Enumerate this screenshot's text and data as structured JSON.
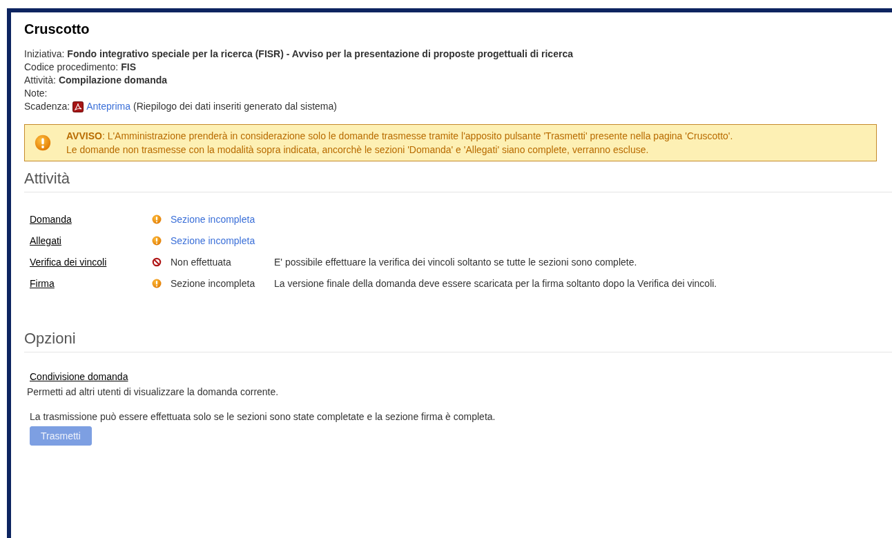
{
  "page": {
    "title": "Cruscotto"
  },
  "info": [
    {
      "label": "Iniziativa:",
      "value": "Fondo integrativo speciale per la ricerca (FISR) - Avviso per la presentazione di proposte progettuali di ricerca"
    },
    {
      "label": "Codice procedimento:",
      "value": "FIS"
    },
    {
      "label": "Attività:",
      "value": "Compilazione domanda"
    },
    {
      "label": "Note:"
    },
    {
      "label": "Scadenza:",
      "link": "Anteprima",
      "note": "(Riepilogo dei dati inseriti generato dal sistema)"
    }
  ],
  "alert": {
    "lines": [
      "**AVVISO**: L'Amministrazione prenderà in considerazione solo le domande trasmesse tramite l'apposito pulsante 'Trasmetti' presente nella pagina 'Cruscotto'.",
      "Le domande non trasmesse con la modalità sopra indicata, ancorchè le sezioni 'Domanda' e 'Allegati' siano complete, verranno escluse."
    ]
  },
  "activities": {
    "heading": "Attività",
    "rows": [
      {
        "name": "Domanda",
        "kind": "warning",
        "status": "Sezione incompleta",
        "status_link": true
      },
      {
        "name": "Allegati",
        "kind": "warning",
        "status": "Sezione incompleta",
        "status_link": true
      },
      {
        "name": "Verifica dei vincoli",
        "kind": "blocked",
        "status": "Non effettuata",
        "status_link": false,
        "note": "E' possibile effettuare la verifica dei vincoli soltanto se tutte le sezioni sono complete."
      },
      {
        "name": "Firma",
        "kind": "warning",
        "status": "Sezione incompleta",
        "status_link": false,
        "note": "La versione finale della domanda deve essere scaricata per la firma soltanto dopo la Verifica dei vincoli."
      }
    ]
  },
  "options": {
    "heading": "Opzioni",
    "link": "Condivisione domanda",
    "description": "Permetti ad altri utenti di visualizzare la domanda corrente.",
    "transmission_note": "La trasmissione può essere effettuata solo se le sezioni sono state completate e la sezione firma è completa.",
    "button": {
      "label": "Trasmetti",
      "disabled": true
    }
  }
}
